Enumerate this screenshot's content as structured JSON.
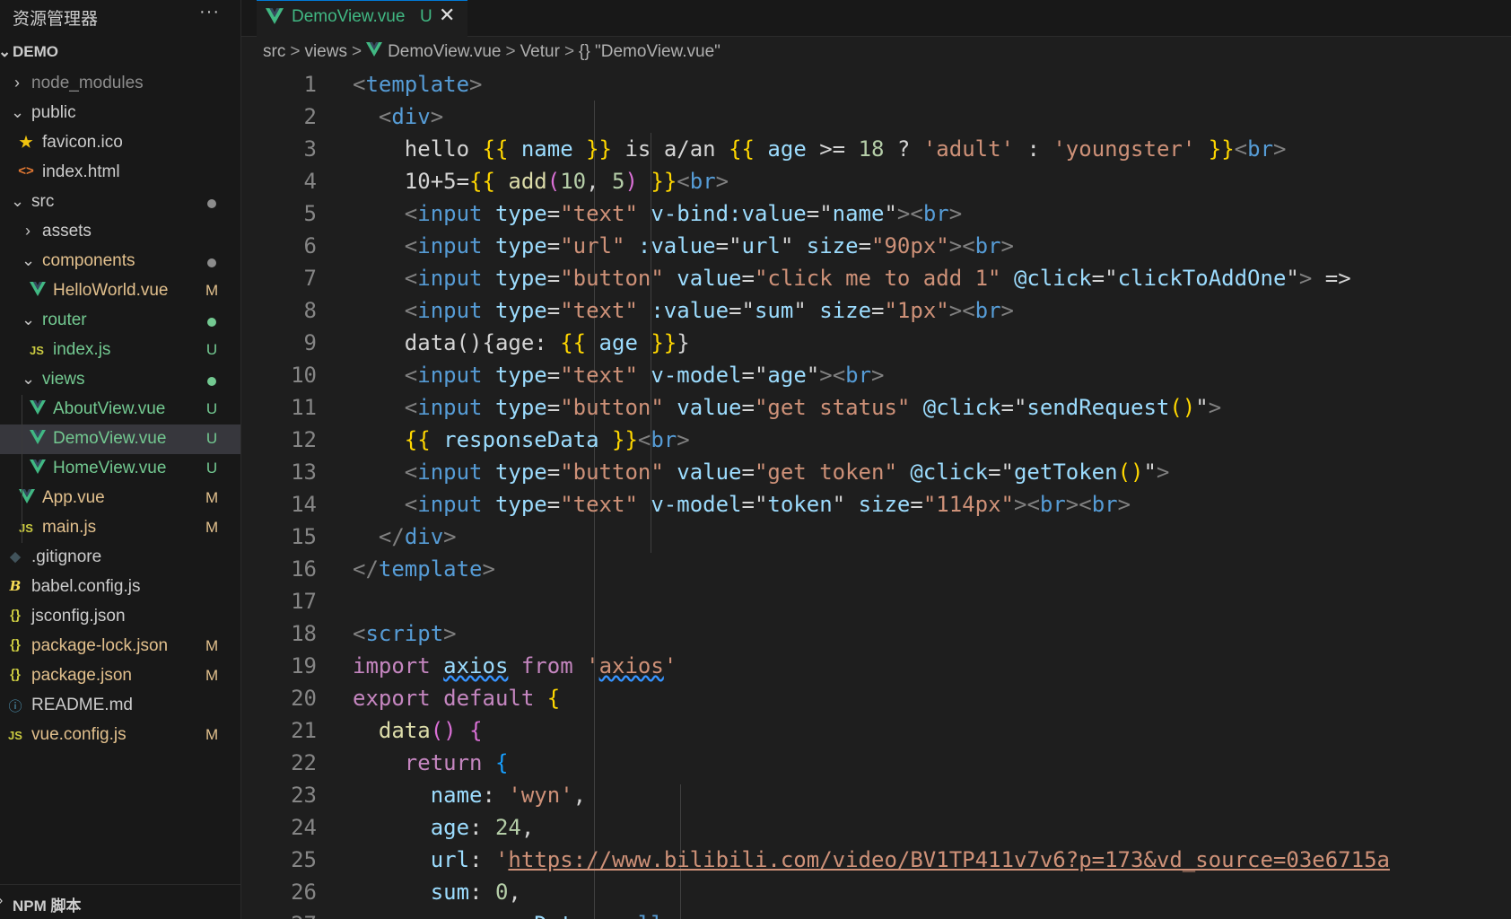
{
  "sidebar": {
    "title": "资源管理器",
    "more_label": "···",
    "project": "DEMO",
    "npm_section": "NPM 脚本",
    "items": [
      {
        "label": "node_modules",
        "status": "",
        "color": "#8c8c8c"
      },
      {
        "label": "public",
        "status": "",
        "color": "#cccccc"
      },
      {
        "label": "favicon.ico",
        "status": "",
        "color": "#cccccc"
      },
      {
        "label": "index.html",
        "status": "",
        "color": "#cccccc"
      },
      {
        "label": "src",
        "status": "dot",
        "color": "#cccccc"
      },
      {
        "label": "assets",
        "status": "",
        "color": "#cccccc"
      },
      {
        "label": "components",
        "status": "dot",
        "color": "#e2c08d"
      },
      {
        "label": "HelloWorld.vue",
        "status": "M",
        "color": "#e2c08d"
      },
      {
        "label": "router",
        "status": "dot",
        "color": "#73c991"
      },
      {
        "label": "index.js",
        "status": "U",
        "color": "#73c991"
      },
      {
        "label": "views",
        "status": "dot",
        "color": "#73c991"
      },
      {
        "label": "AboutView.vue",
        "status": "U",
        "color": "#73c991"
      },
      {
        "label": "DemoView.vue",
        "status": "U",
        "color": "#73c991"
      },
      {
        "label": "HomeView.vue",
        "status": "U",
        "color": "#73c991"
      },
      {
        "label": "App.vue",
        "status": "M",
        "color": "#e2c08d"
      },
      {
        "label": "main.js",
        "status": "M",
        "color": "#e2c08d"
      },
      {
        "label": ".gitignore",
        "status": "",
        "color": "#cccccc"
      },
      {
        "label": "babel.config.js",
        "status": "",
        "color": "#cccccc"
      },
      {
        "label": "jsconfig.json",
        "status": "",
        "color": "#cccccc"
      },
      {
        "label": "package-lock.json",
        "status": "M",
        "color": "#e2c08d"
      },
      {
        "label": "package.json",
        "status": "M",
        "color": "#e2c08d"
      },
      {
        "label": "README.md",
        "status": "",
        "color": "#cccccc"
      },
      {
        "label": "vue.config.js",
        "status": "M",
        "color": "#e2c08d"
      }
    ],
    "icons": {
      "js": "JS",
      "json": "{}",
      "html": "<>",
      "info": "ⓘ"
    }
  },
  "tab": {
    "label": "DemoView.vue",
    "status": "U",
    "close": "✕"
  },
  "breadcrumb": {
    "parts": [
      "src",
      "views",
      "DemoView.vue",
      "Vetur",
      "{} \"DemoView.vue\""
    ],
    "sep": ">"
  },
  "editor": {
    "line_numbers": [
      "1",
      "2",
      "3",
      "4",
      "5",
      "6",
      "7",
      "8",
      "9",
      "10",
      "11",
      "12",
      "13",
      "14",
      "15",
      "16",
      "17",
      "18",
      "19",
      "20",
      "21",
      "22",
      "23",
      "24",
      "25",
      "26",
      "27"
    ],
    "lines": [
      "<template>",
      "  <div>",
      "    hello {{ name }} is a/an {{ age >= 18 ? 'adult' : 'youngster' }}<br>",
      "    10+5={{ add(10, 5) }}<br>",
      "    <input type=\"text\" v-bind:value=\"name\"><br>",
      "    <input type=\"url\" :value=\"url\" size=\"90px\"><br>",
      "    <input type=\"button\" value=\"click me to add 1\" @click=\"clickToAddOne\"> =>",
      "    <input type=\"text\" :value=\"sum\" size=\"1px\"><br>",
      "    data(){age: {{ age }}}",
      "    <input type=\"text\" v-model=\"age\"><br>",
      "    <input type=\"button\" value=\"get status\" @click=\"sendRequest()\">",
      "    {{ responseData }}<br>",
      "    <input type=\"button\" value=\"get token\" @click=\"getToken()\">",
      "    <input type=\"text\" v-model=\"token\" size=\"114px\"><br><br>",
      "  </div>",
      "</template>",
      "",
      "<script>",
      "import axios from 'axios'",
      "export default {",
      "  data() {",
      "    return {",
      "      name: 'wyn',",
      "      age: 24,",
      "      url: 'https://www.bilibili.com/video/BV1TP411v7v6?p=173&vd_source=03e6715a",
      "      sum: 0,",
      "      responseData: null,"
    ]
  },
  "colors": {
    "vue": "#41b883",
    "accent": "#0078d4",
    "modified": "#e2c08d",
    "untracked": "#73c991",
    "js": "#cbcb41",
    "json": "#cbcb41",
    "html": "#e37933",
    "info": "#519aba",
    "gitignore": "#41535b",
    "babel": "#f5da55",
    "favicon": "#f1c40f"
  }
}
